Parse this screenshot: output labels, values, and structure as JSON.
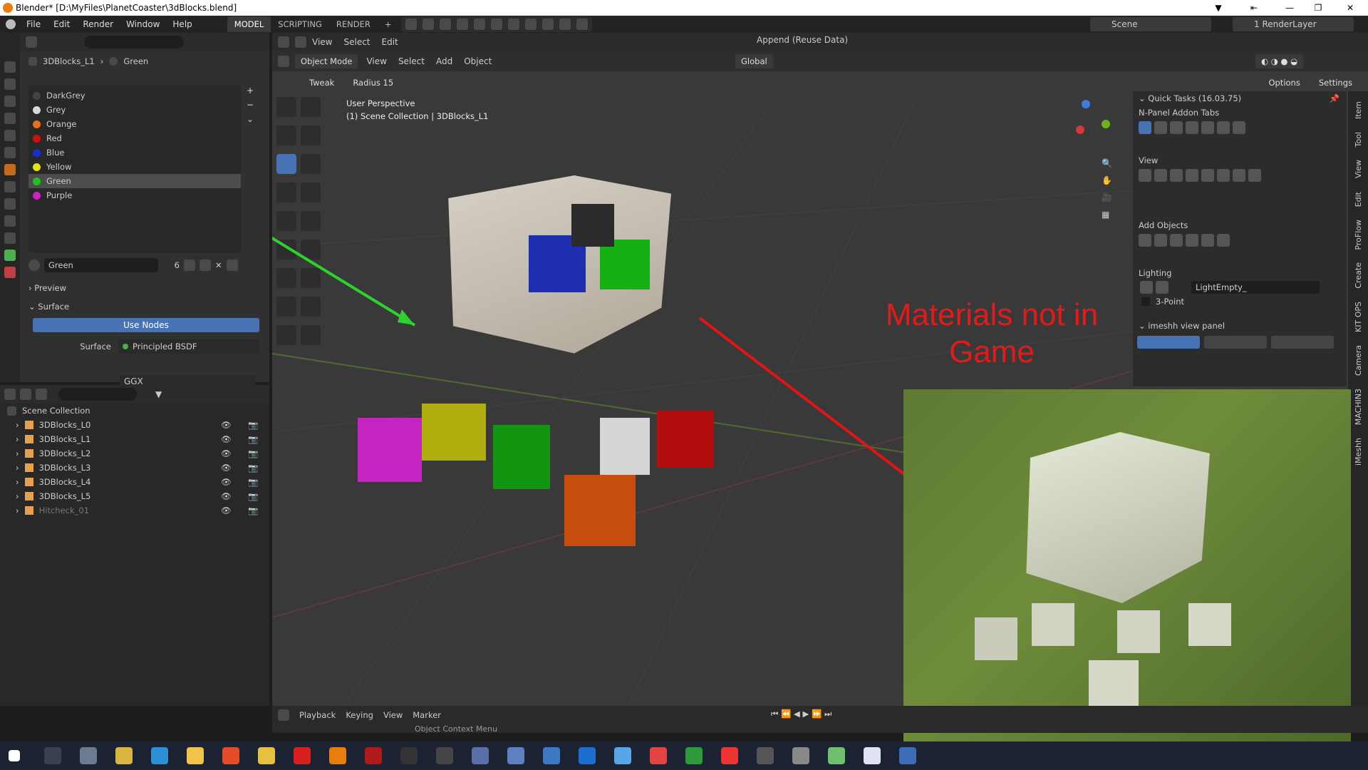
{
  "window": {
    "title": "Blender* [D:\\MyFiles\\PlanetCoaster\\3dBlocks.blend]"
  },
  "menu": [
    "File",
    "Edit",
    "Render",
    "Window",
    "Help"
  ],
  "workspaces": [
    "MODEL",
    "SCRIPTING",
    "RENDER"
  ],
  "scene": {
    "name": "Scene",
    "renderlayer": "1 RenderLayer"
  },
  "props": {
    "breadcrumb_object": "3DBlocks_L1",
    "breadcrumb_material": "Green",
    "materials": [
      {
        "name": "DarkGrey",
        "color": "#444444"
      },
      {
        "name": "Grey",
        "color": "#d8d8d8"
      },
      {
        "name": "Orange",
        "color": "#e8701a"
      },
      {
        "name": "Red",
        "color": "#d01010"
      },
      {
        "name": "Blue",
        "color": "#1430d0"
      },
      {
        "name": "Yellow",
        "color": "#e8e010"
      },
      {
        "name": "Green",
        "color": "#20c020"
      },
      {
        "name": "Purple",
        "color": "#d020c0"
      }
    ],
    "active_material": "Green",
    "users": "6",
    "preview_label": "Preview",
    "surface_label": "Surface",
    "use_nodes": "Use Nodes",
    "surface_field_label": "Surface",
    "surface_value": "Principled BSDF",
    "distribution": "GGX"
  },
  "outliner": {
    "root": "Scene Collection",
    "items": [
      "3DBlocks_L0",
      "3DBlocks_L1",
      "3DBlocks_L2",
      "3DBlocks_L3",
      "3DBlocks_L4",
      "3DBlocks_L5",
      "Hitcheck_01"
    ]
  },
  "viewport": {
    "header_menus": [
      "View",
      "Select",
      "Edit"
    ],
    "append": "Append (Reuse Data)",
    "mode": "Object Mode",
    "menus2": [
      "View",
      "Select",
      "Add",
      "Object"
    ],
    "orientation": "Global",
    "tweak": "Tweak",
    "radius_label": "Radius",
    "radius_value": "15",
    "perspective": "User Perspective",
    "collection_info": "(1) Scene Collection | 3DBlocks_L1",
    "options": "Options",
    "settings": "Settings",
    "annotation": "Materials not in Game"
  },
  "npanel": {
    "title": "Quick Tasks (16.03.75)",
    "addon_tabs": "N-Panel Addon Tabs",
    "view": "View",
    "add_objects": "Add Objects",
    "lighting": "Lighting",
    "light_value": "LightEmpty_",
    "three_point": "3-Point",
    "imeshh": "imeshh view panel",
    "side_tabs": [
      "Item",
      "Tool",
      "View",
      "Edit",
      "ProFlow",
      "Create",
      "KIT OPS",
      "Camera",
      "MACHIN3",
      "iMeshh"
    ]
  },
  "timeline": {
    "menus": [
      "Playback",
      "Keying",
      "View",
      "Marker"
    ],
    "status": "Object Context Menu"
  }
}
